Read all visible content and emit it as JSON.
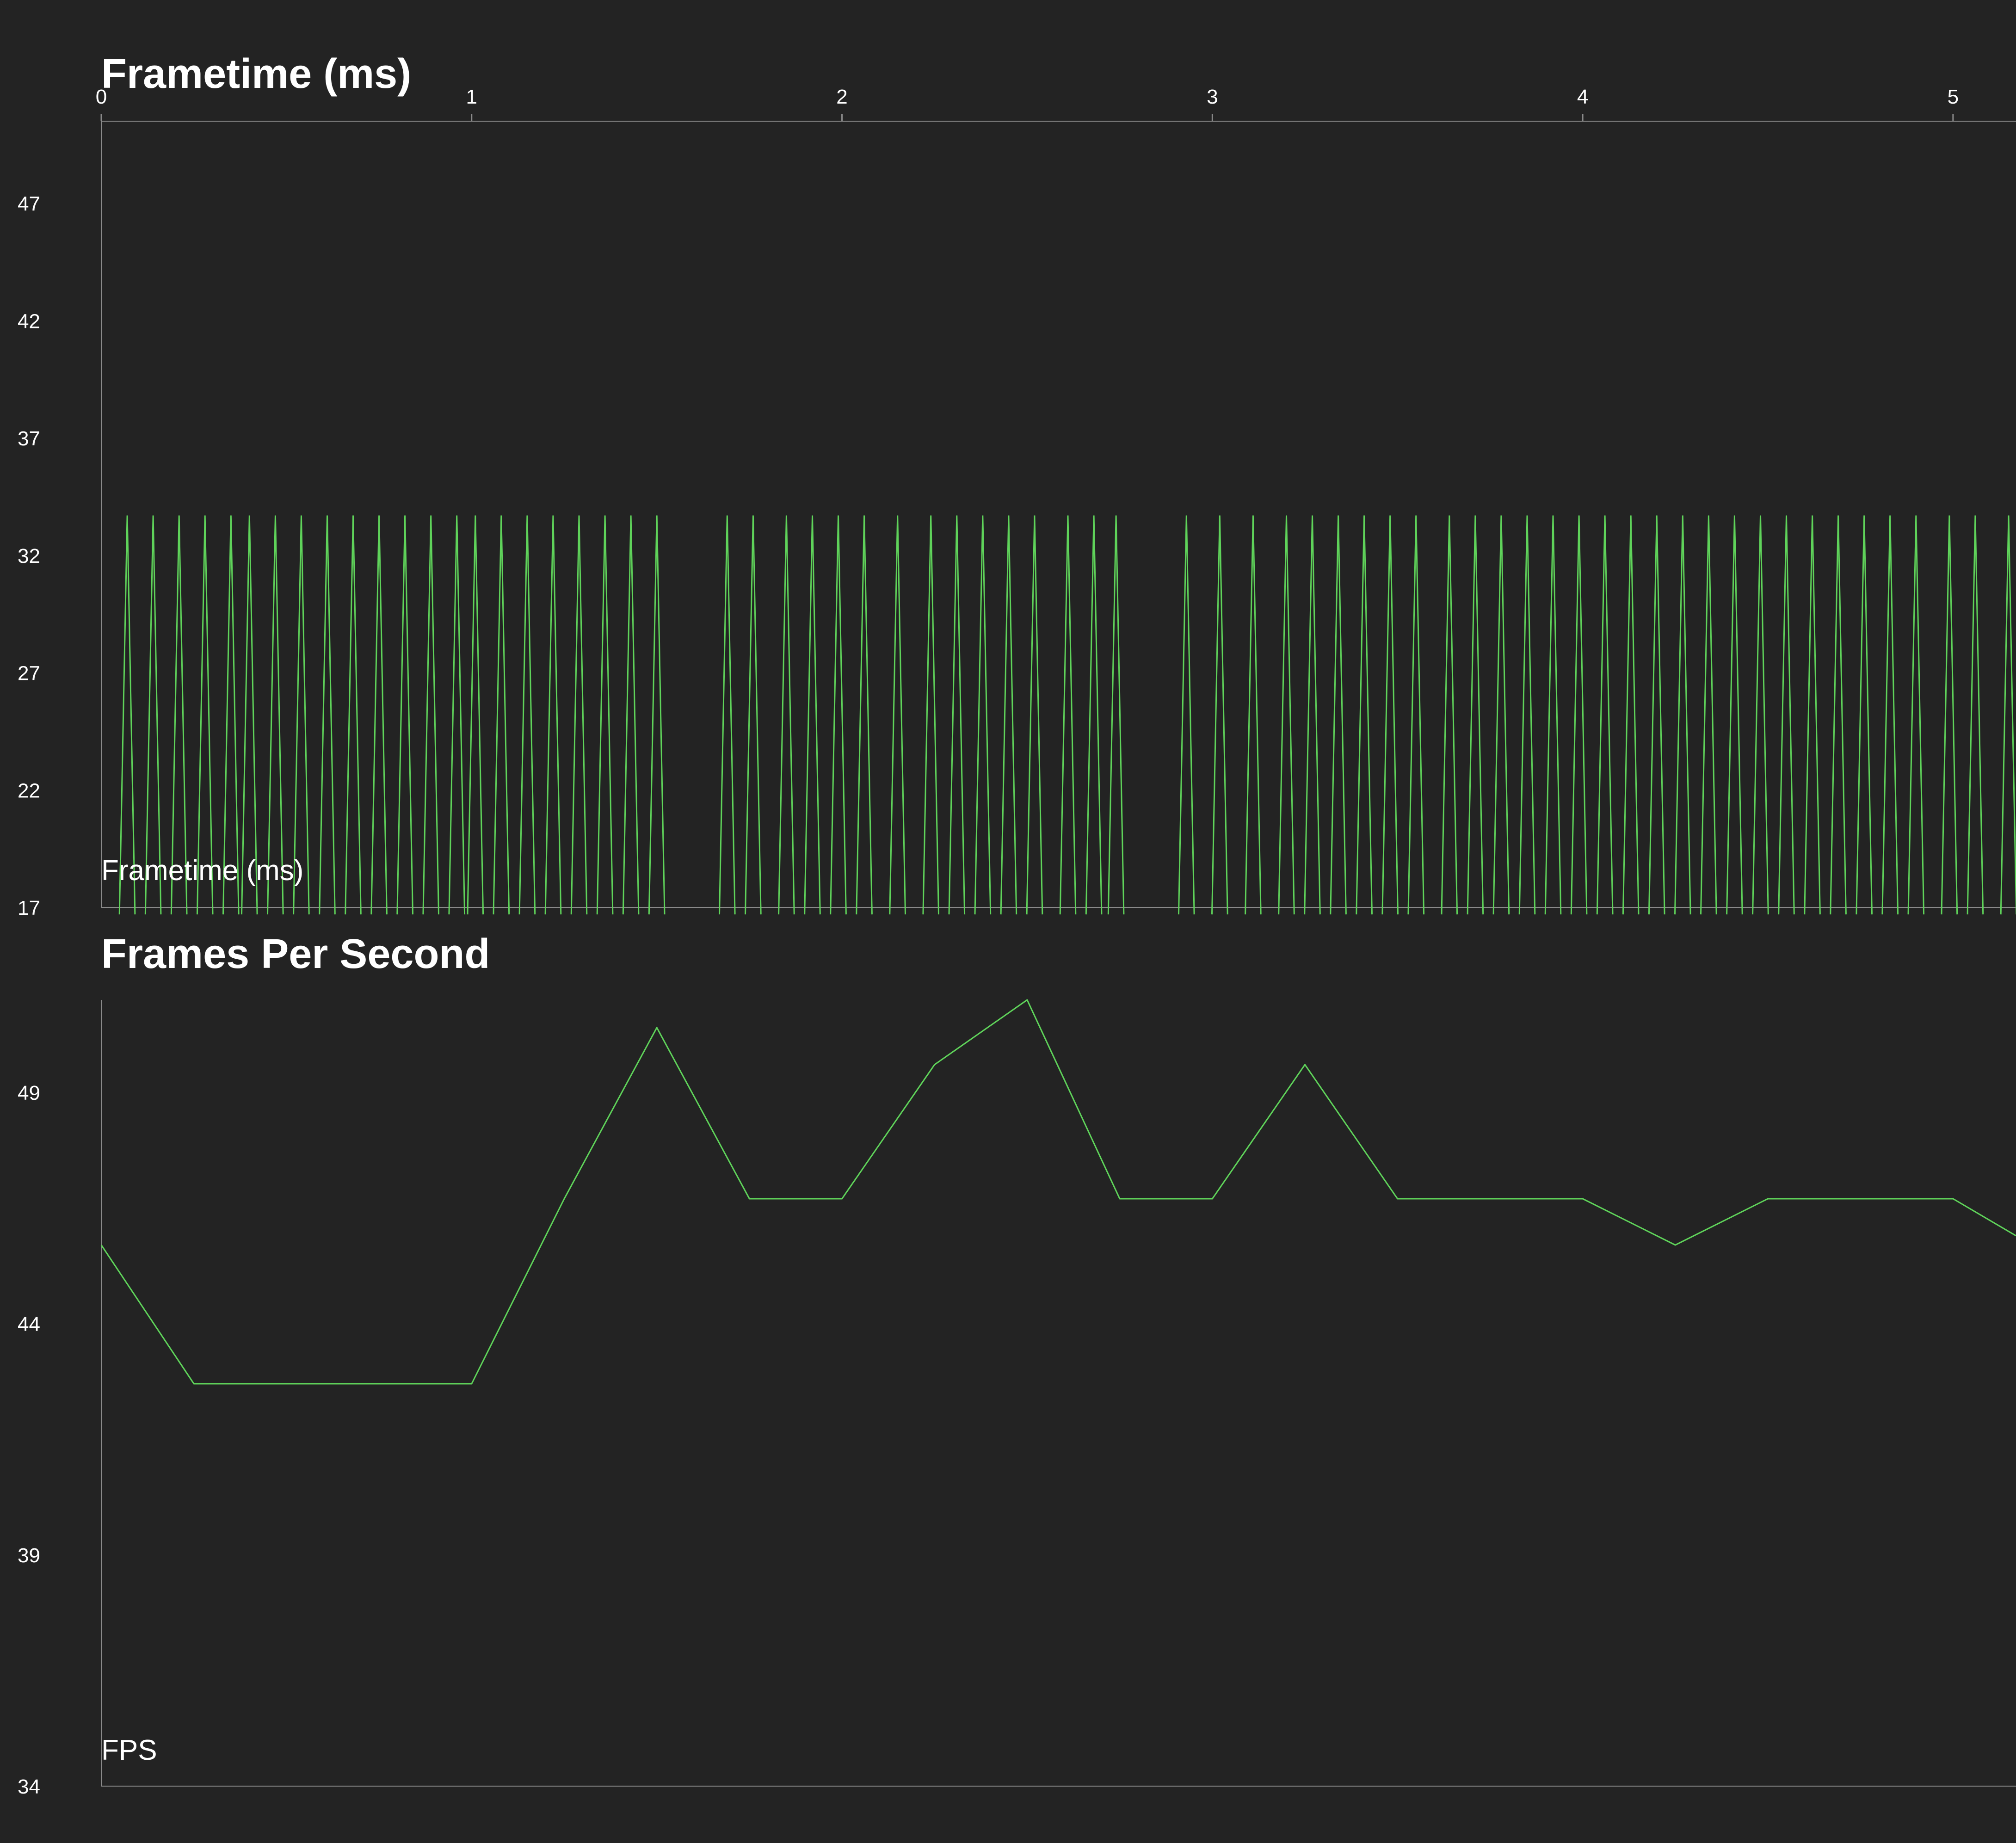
{
  "colors": {
    "background": "#232323",
    "series": "#5fd35a",
    "axis": "#8a8a8a",
    "text": "#ffffff"
  },
  "chart_data": [
    {
      "type": "line",
      "title": "Frametime (ms)",
      "series_label": "Frametime (ms)",
      "xlabel": "",
      "ylabel": "",
      "x_ticks": [
        0,
        1,
        2,
        3,
        4,
        5
      ],
      "y_ticks": [
        17,
        22,
        27,
        32,
        37,
        42,
        47
      ],
      "xlim": [
        0,
        5.17
      ],
      "ylim": [
        17,
        50.5
      ],
      "grid": false,
      "series": [
        {
          "spike_times": [
            0.07,
            0.14,
            0.21,
            0.28,
            0.35,
            0.4,
            0.47,
            0.54,
            0.61,
            0.68,
            0.75,
            0.82,
            0.89,
            0.96,
            1.01,
            1.08,
            1.15,
            1.22,
            1.29,
            1.36,
            1.43,
            1.5,
            1.69,
            1.76,
            1.85,
            1.92,
            1.99,
            2.06,
            2.15,
            2.24,
            2.31,
            2.38,
            2.45,
            2.52,
            2.61,
            2.68,
            2.74,
            2.93,
            3.02,
            3.11,
            3.2,
            3.27,
            3.34,
            3.41,
            3.48,
            3.55,
            3.64,
            3.71,
            3.78,
            3.85,
            3.92,
            3.99,
            4.06,
            4.13,
            4.2,
            4.27,
            4.34,
            4.41,
            4.48,
            4.55,
            4.62,
            4.69,
            4.76,
            4.83,
            4.9,
            4.99,
            5.06,
            5.15
          ],
          "peak_value": 33.7,
          "base_value": 16.7
        }
      ]
    },
    {
      "type": "line",
      "title": "Frames Per Second",
      "series_label": "FPS",
      "xlabel": "",
      "ylabel": "",
      "y_ticks": [
        34,
        39,
        44,
        49
      ],
      "xlim": [
        0,
        5.17
      ],
      "ylim": [
        34,
        51
      ],
      "grid": false,
      "series": [
        {
          "x": [
            0,
            0.25,
            0.5,
            0.75,
            1.0,
            1.25,
            1.5,
            1.75,
            2.0,
            2.25,
            2.5,
            2.75,
            3.0,
            3.25,
            3.5,
            3.75,
            4.0,
            4.25,
            4.5,
            4.75,
            5.0,
            5.17
          ],
          "y": [
            45.7,
            42.7,
            42.7,
            42.7,
            42.7,
            46.7,
            50.4,
            46.7,
            46.7,
            49.6,
            51.0,
            46.7,
            46.7,
            49.6,
            46.7,
            46.7,
            46.7,
            45.7,
            46.7,
            46.7,
            46.7,
            45.9
          ]
        }
      ]
    }
  ]
}
